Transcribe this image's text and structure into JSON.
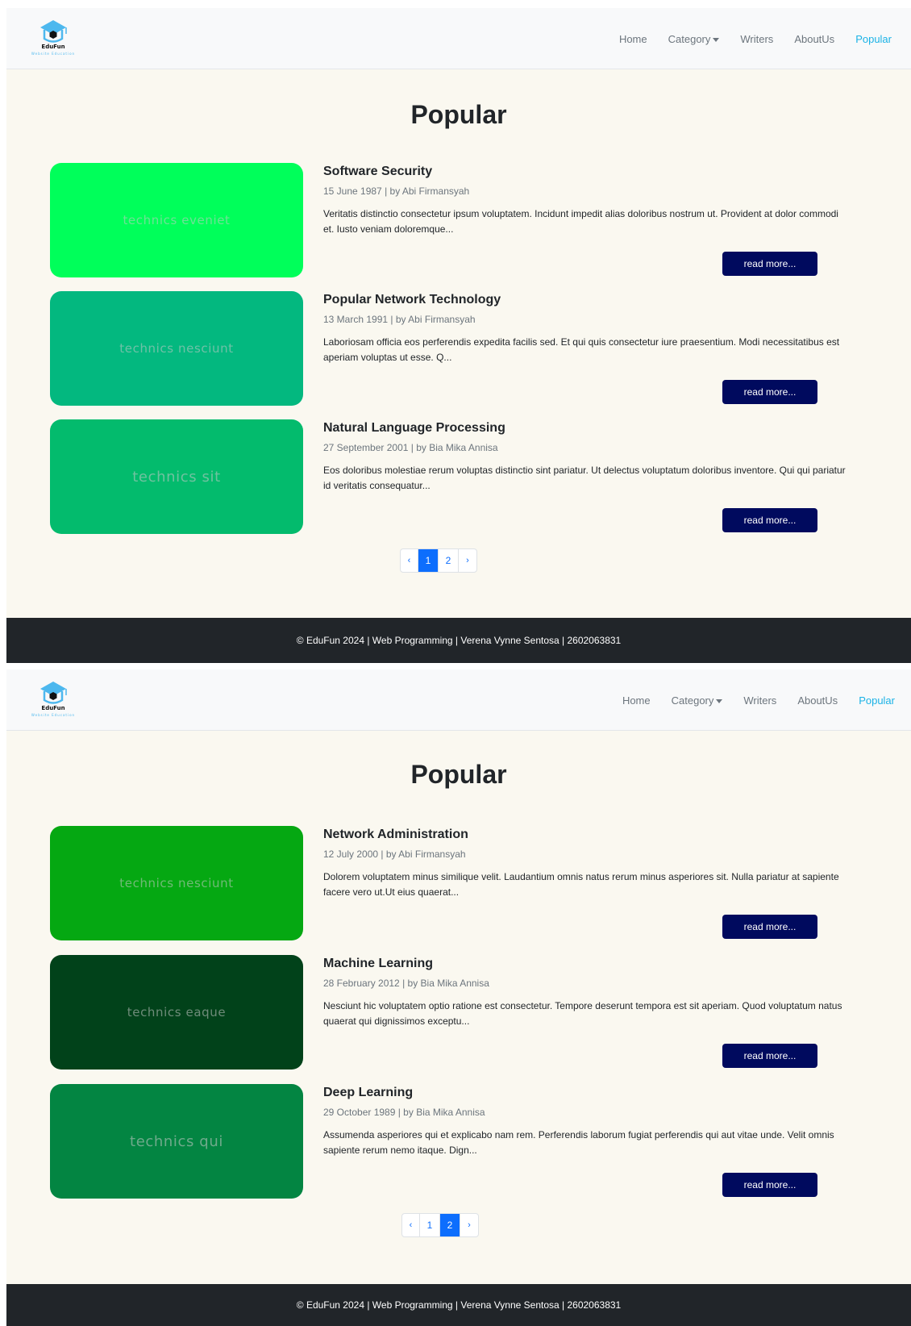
{
  "brand": {
    "name": "EduFun",
    "tagline": "Website Education"
  },
  "nav": {
    "home": "Home",
    "category": "Category",
    "writers": "Writers",
    "about": "AboutUs",
    "popular": "Popular"
  },
  "colors": {
    "accent": "#1ab2e6",
    "button": "#000a5e",
    "footer_bg": "#212529",
    "page_bg": "#faf8f0"
  },
  "pages": [
    {
      "title": "Popular",
      "articles": [
        {
          "title": "Software Security",
          "meta": "15 June 1987 | by Abi Firmansyah",
          "excerpt": "Veritatis distinctio consectetur ipsum voluptatem. Incidunt impedit alias doloribus nostrum ut. Provident at dolor commodi et. Iusto veniam doloremque...",
          "image_text": "technics eveniet",
          "image_color": "#00ff5a",
          "button": "read more..."
        },
        {
          "title": "Popular Network Technology",
          "meta": "13 March 1991 | by Abi Firmansyah",
          "excerpt": "Laboriosam officia eos perferendis expedita facilis sed. Et qui quis consectetur iure praesentium. Modi necessitatibus est aperiam voluptas ut esse. Q...",
          "image_text": "technics nesciunt",
          "image_color": "#03b87f",
          "button": "read more..."
        },
        {
          "title": "Natural Language Processing",
          "meta": "27 September 2001 | by Bia Mika Annisa",
          "excerpt": "Eos doloribus molestiae rerum voluptas distinctio sint pariatur. Ut delectus voluptatum doloribus inventore. Qui qui pariatur id veritatis consequatur...",
          "image_text": "technics sit",
          "image_color": "#03bb6d",
          "button": "read more..."
        }
      ],
      "pagination": {
        "prev": "‹",
        "pages": [
          "1",
          "2"
        ],
        "next": "›",
        "active": "1"
      },
      "footer": "© EduFun 2024 | Web Programming | Verena Vynne Sentosa | 2602063831"
    },
    {
      "title": "Popular",
      "articles": [
        {
          "title": "Network Administration",
          "meta": "12 July 2000 | by Abi Firmansyah",
          "excerpt": "Dolorem voluptatem minus similique velit. Laudantium omnis natus rerum minus asperiores sit. Nulla pariatur at sapiente facere vero ut.Ut eius quaerat...",
          "image_text": "technics nesciunt",
          "image_color": "#05a812",
          "button": "read more..."
        },
        {
          "title": "Machine Learning",
          "meta": "28 February 2012 | by Bia Mika Annisa",
          "excerpt": "Nesciunt hic voluptatem optio ratione est consectetur. Tempore deserunt tempora est sit aperiam. Quod voluptatum natus quaerat qui dignissimos exceptu...",
          "image_text": "technics eaque",
          "image_color": "#01421a",
          "button": "read more..."
        },
        {
          "title": "Deep Learning",
          "meta": "29 October 1989 | by Bia Mika Annisa",
          "excerpt": "Assumenda asperiores qui et explicabo nam rem. Perferendis laborum fugiat perferendis qui aut vitae unde. Velit omnis sapiente rerum nemo itaque. Dign...",
          "image_text": "technics qui",
          "image_color": "#038542",
          "button": "read more..."
        }
      ],
      "pagination": {
        "prev": "‹",
        "pages": [
          "1",
          "2"
        ],
        "next": "›",
        "active": "2"
      },
      "footer": "© EduFun 2024 | Web Programming | Verena Vynne Sentosa | 2602063831"
    }
  ]
}
